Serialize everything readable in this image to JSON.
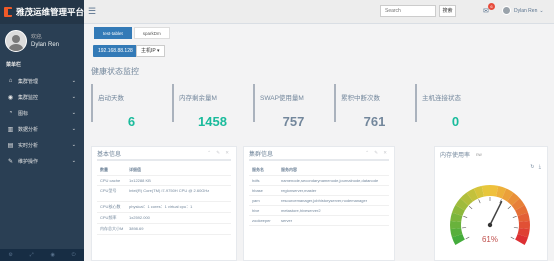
{
  "brand": {
    "title": "雅茂运维管理平台"
  },
  "profile": {
    "welcome": "欢迎,",
    "name": "Dylan Ren"
  },
  "sidebar": {
    "section": "菜单栏",
    "items": [
      {
        "label": "集群管理",
        "icon": "home-icon"
      },
      {
        "label": "集群监控",
        "icon": "eye-icon"
      },
      {
        "label": "图标",
        "icon": "chart-icon"
      },
      {
        "label": "数据分析",
        "icon": "bar-icon"
      },
      {
        "label": "实时分析",
        "icon": "table-icon"
      },
      {
        "label": "维护操作",
        "icon": "wrench-icon"
      }
    ]
  },
  "topbar": {
    "search_placeholder": "Search",
    "search_button": "搜索",
    "badge": "6",
    "user": "Dylan Ren"
  },
  "tabs": [
    "test-tablet",
    "sparkDm"
  ],
  "ip": {
    "value": "192.168.88.128",
    "dropdown": "主机IP"
  },
  "page_title": "健康状态监控",
  "stats": [
    {
      "label": "启动天数",
      "value": "6",
      "green": true
    },
    {
      "label": "内存剩余量M",
      "value": "1458",
      "green": true
    },
    {
      "label": "SWAP使用量M",
      "value": "757",
      "green": false
    },
    {
      "label": "累积中断次数",
      "value": "761",
      "green": false
    },
    {
      "label": "主机连接状态",
      "value": "0",
      "green": true
    }
  ],
  "basic_info": {
    "title": "基本信息",
    "header": [
      "数量",
      "详细值"
    ],
    "rows": [
      [
        "CPU cache",
        "1x12288 KB"
      ],
      [
        "CPU型号",
        "Intel(R) Core(TM) i7-9750H CPU @ 2.60GHz"
      ],
      [
        "CPU核心数",
        "physical：1 cores：1 virtual cpu：1"
      ],
      [
        "CPU频率",
        "1x2592.000"
      ],
      [
        "内存总大小M",
        "3898.69"
      ]
    ]
  },
  "cluster_info": {
    "title": "集群信息",
    "header": [
      "服务名",
      "服务内容"
    ],
    "rows": [
      [
        "hdfs",
        "namenode,secondarynamenode,journalnode,datanode"
      ],
      [
        "hbase",
        "regionserver,master"
      ],
      [
        "yarn",
        "resourcemanager,jobhistoryserver,nodemanager"
      ],
      [
        "hive",
        "metastore,hiveserver2"
      ],
      [
        "zookeeper",
        "server"
      ]
    ]
  },
  "memory_panel": {
    "title": "内存使用率",
    "subtitle": "nw",
    "value": 0.61,
    "label": "61%"
  }
}
